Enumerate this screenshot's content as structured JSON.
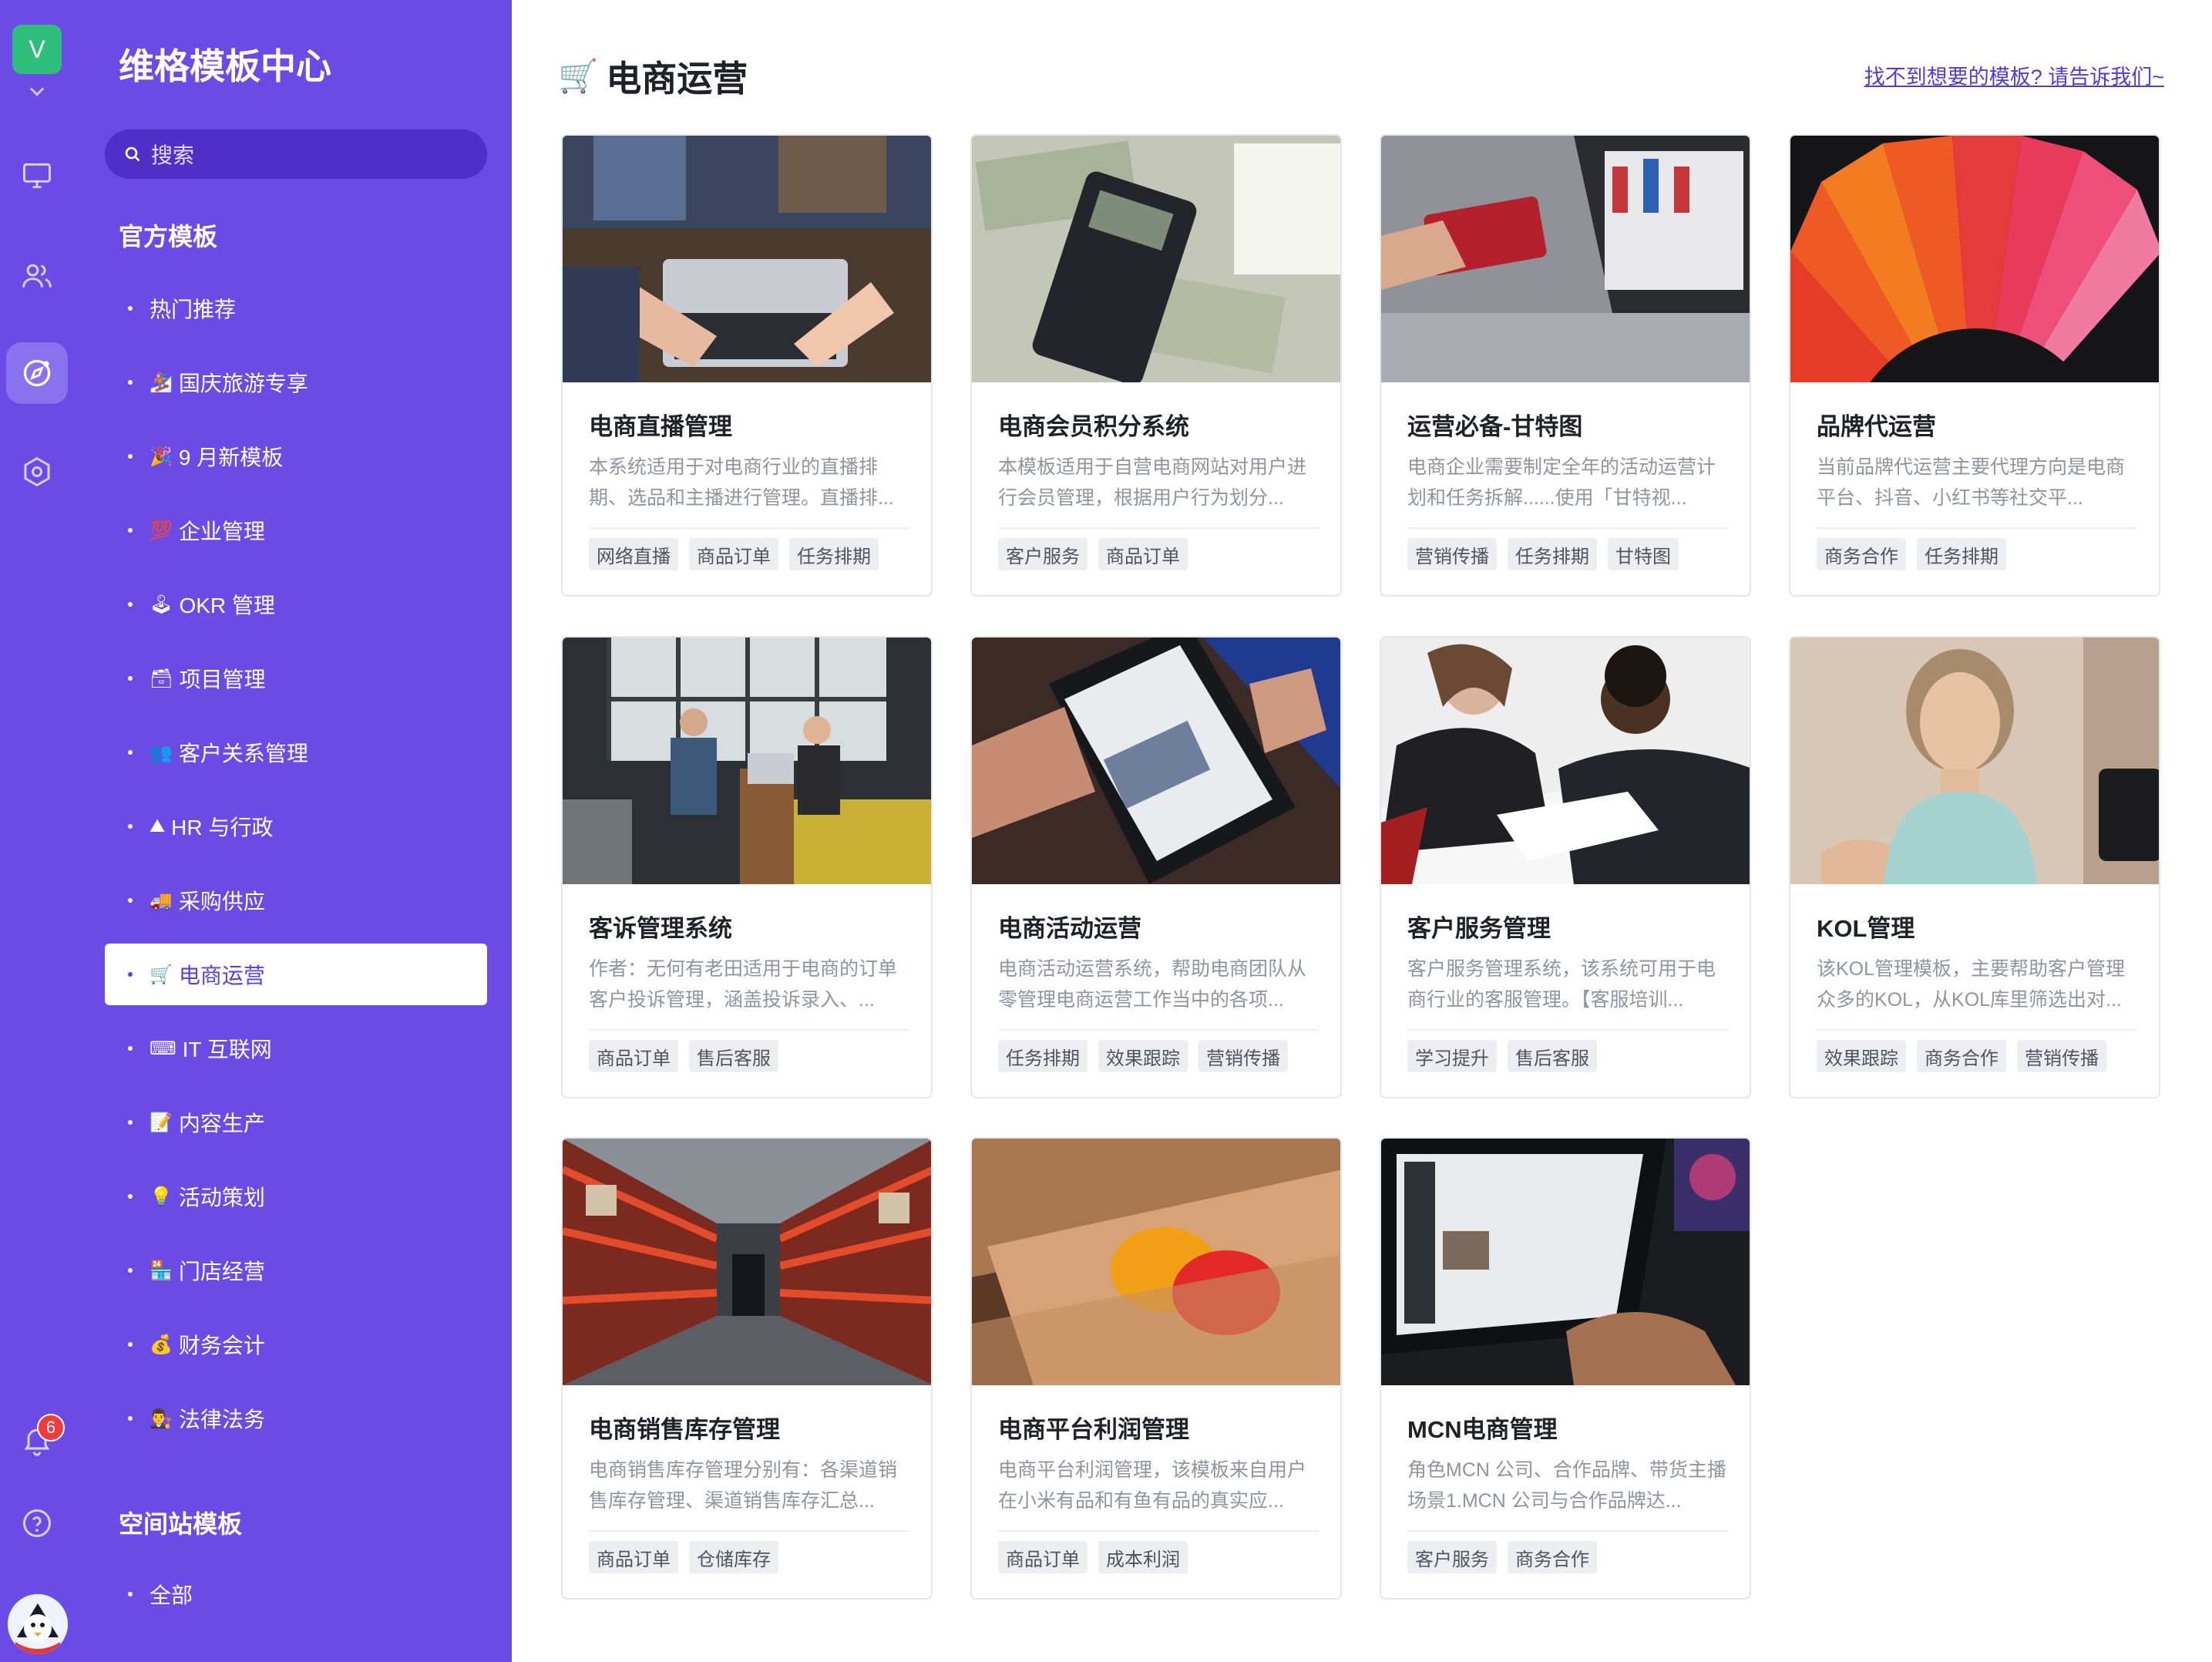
{
  "rail": {
    "avatar_letter": "V",
    "notification_count": "6",
    "icons": [
      "monitor-icon",
      "users-icon",
      "compass-icon",
      "hexagon-settings-icon",
      "bell-icon",
      "help-icon"
    ]
  },
  "sidebar": {
    "title": "维格模板中心",
    "search_placeholder": "搜索",
    "section_official": "官方模板",
    "items": [
      {
        "emoji": "",
        "label": "热门推荐"
      },
      {
        "emoji": "🏂",
        "label": "国庆旅游专享"
      },
      {
        "emoji": "🎉",
        "label": "9 月新模板"
      },
      {
        "emoji": "💯",
        "label": "企业管理"
      },
      {
        "emoji": "🕹",
        "label": "OKR 管理"
      },
      {
        "emoji": "🗃",
        "label": "项目管理"
      },
      {
        "emoji": "👥",
        "label": "客户关系管理"
      },
      {
        "emoji": "⛰",
        "label": "HR 与行政"
      },
      {
        "emoji": "🚚",
        "label": "采购供应"
      },
      {
        "emoji": "🛒",
        "label": "电商运营"
      },
      {
        "emoji": "⌨",
        "label": "IT 互联网"
      },
      {
        "emoji": "📝",
        "label": "内容生产"
      },
      {
        "emoji": "💡",
        "label": "活动策划"
      },
      {
        "emoji": "🏪",
        "label": "门店经营"
      },
      {
        "emoji": "💰",
        "label": "财务会计"
      },
      {
        "emoji": "👨‍⚖️",
        "label": "法律法务"
      }
    ],
    "section_space": "空间站模板",
    "space_items": [
      {
        "label": "全部"
      }
    ]
  },
  "main": {
    "title": "电商运营",
    "title_emoji": "🛒",
    "help_link": "找不到想要的模板? 请告诉我们~",
    "cards": [
      {
        "title": "电商直播管理",
        "desc": "本系统适用于对电商行业的直播排期、选品和主播进行管理。直播排...",
        "tags": [
          "网络直播",
          "商品订单",
          "任务排期"
        ],
        "image": "laptop-hands-photo"
      },
      {
        "title": "电商会员积分系统",
        "desc": "本模板适用于自营电商网站对用户进行会员管理，根据用户行为划分...",
        "tags": [
          "客户服务",
          "商品订单"
        ],
        "image": "calculator-money-photo"
      },
      {
        "title": "运营必备-甘特图",
        "desc": "电商企业需要制定全年的活动运营计划和任务拆解......使用「甘特视...",
        "tags": [
          "营销传播",
          "任务排期",
          "甘特图"
        ],
        "image": "credit-card-laptop-photo"
      },
      {
        "title": "品牌代运营",
        "desc": "当前品牌代运营主要代理方向是电商平台、抖音、小红书等社交平...",
        "tags": [
          "商务合作",
          "任务排期"
        ],
        "image": "consumers-users-wheel-photo"
      },
      {
        "title": "客诉管理系统",
        "desc": "作者：无何有老田适用于电商的订单客户投诉管理，涵盖投诉录入、...",
        "tags": [
          "商品订单",
          "售后客服"
        ],
        "image": "office-meeting-photo"
      },
      {
        "title": "电商活动运营",
        "desc": "电商活动运营系统，帮助电商团队从零管理电商运营工作当中的各项...",
        "tags": [
          "任务排期",
          "效果跟踪",
          "营销传播"
        ],
        "image": "phone-shopping-photo"
      },
      {
        "title": "客户服务管理",
        "desc": "客户服务管理系统，该系统可用于电商行业的客服管理。【客服培训...",
        "tags": [
          "学习提升",
          "售后客服"
        ],
        "image": "business-signing-photo"
      },
      {
        "title": "KOL管理",
        "desc": "该KOL管理模板，主要帮助客户管理众多的KOL，从KOL库里筛选出对...",
        "tags": [
          "效果跟踪",
          "商务合作",
          "营销传播"
        ],
        "image": "influencer-woman-photo"
      },
      {
        "title": "电商销售库存管理",
        "desc": "电商销售库存管理分别有：各渠道销售库存管理、渠道销售库存汇总...",
        "tags": [
          "商品订单",
          "仓储库存"
        ],
        "image": "warehouse-shelves-photo"
      },
      {
        "title": "电商平台利润管理",
        "desc": "电商平台利润管理，该模板来自用户在小米有品和有鱼有品的真实应...",
        "tags": [
          "商品订单",
          "成本利润"
        ],
        "image": "bank-cards-photo"
      },
      {
        "title": "MCN电商管理",
        "desc": "角色MCN 公司、合作品牌、带货主播场景1.MCN 公司与合作品牌达...",
        "tags": [
          "客户服务",
          "商务合作"
        ],
        "image": "laptop-typing-photo"
      }
    ]
  }
}
